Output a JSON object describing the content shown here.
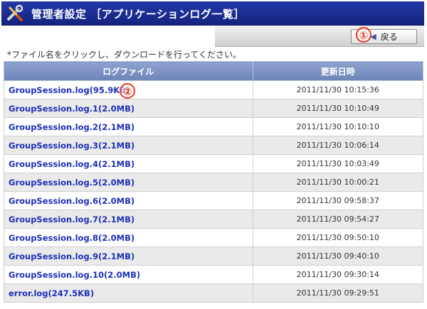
{
  "header": {
    "title": "管理者設定 ［アプリケーションログ一覧］",
    "icon": "tools-icon"
  },
  "toolbar": {
    "back_label": "戻る",
    "back_icon": "back-arrow-icon"
  },
  "markers": {
    "m1": "①",
    "m2": "②"
  },
  "note": "*ファイル名をクリックし、ダウンロードを行ってください。",
  "table": {
    "headers": [
      "ログファイル",
      "更新日時"
    ],
    "rows": [
      {
        "file": "GroupSession.log(95.9KB)",
        "date": "2011/11/30 10:15:36"
      },
      {
        "file": "GroupSession.log.1(2.0MB)",
        "date": "2011/11/30 10:10:49"
      },
      {
        "file": "GroupSession.log.2(2.1MB)",
        "date": "2011/11/30 10:10:10"
      },
      {
        "file": "GroupSession.log.3(2.1MB)",
        "date": "2011/11/30 10:06:14"
      },
      {
        "file": "GroupSession.log.4(2.1MB)",
        "date": "2011/11/30 10:03:49"
      },
      {
        "file": "GroupSession.log.5(2.0MB)",
        "date": "2011/11/30 10:00:21"
      },
      {
        "file": "GroupSession.log.6(2.0MB)",
        "date": "2011/11/30 09:58:37"
      },
      {
        "file": "GroupSession.log.7(2.1MB)",
        "date": "2011/11/30 09:54:27"
      },
      {
        "file": "GroupSession.log.8(2.0MB)",
        "date": "2011/11/30 09:50:10"
      },
      {
        "file": "GroupSession.log.9(2.1MB)",
        "date": "2011/11/30 09:40:10"
      },
      {
        "file": "GroupSession.log.10(2.0MB)",
        "date": "2011/11/30 09:30:14"
      },
      {
        "file": "error.log(247.5KB)",
        "date": "2011/11/30 09:29:51"
      }
    ]
  },
  "colors": {
    "title_bar": "#1a2a90",
    "header_row": "#7d93c3",
    "link": "#1d2fb8",
    "marker": "#e53a1f"
  }
}
